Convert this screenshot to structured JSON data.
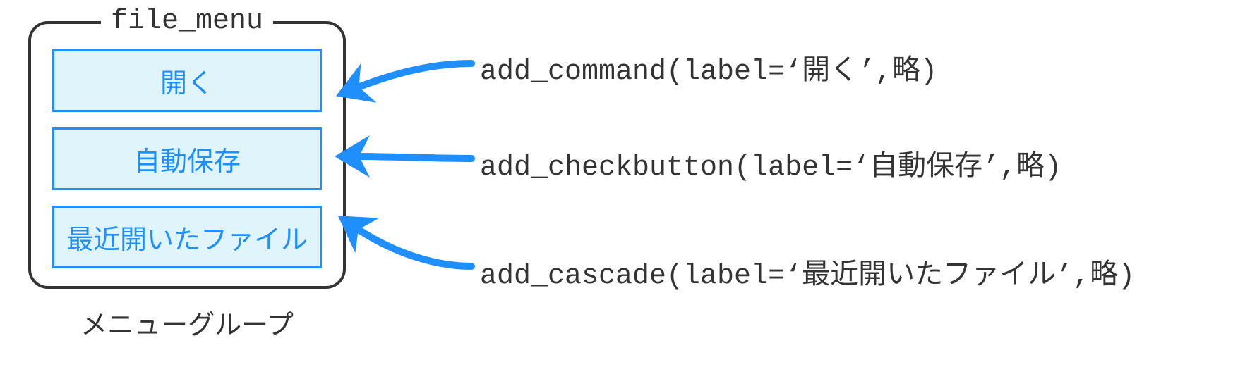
{
  "menu": {
    "title": "file_menu",
    "items": [
      {
        "label": "開く"
      },
      {
        "label": "自動保存"
      },
      {
        "label": "最近開いたファイル"
      }
    ],
    "caption": "メニューグループ"
  },
  "annotations": [
    {
      "code": "add_command(label=‘開く’,略)"
    },
    {
      "code": "add_checkbutton(label=‘自動保存’,略)"
    },
    {
      "code": "add_cascade(label=‘最近開いたファイル’,略)"
    }
  ],
  "colors": {
    "accent": "#1f8fff",
    "item_bg": "#dff4fb",
    "border": "#333333"
  }
}
